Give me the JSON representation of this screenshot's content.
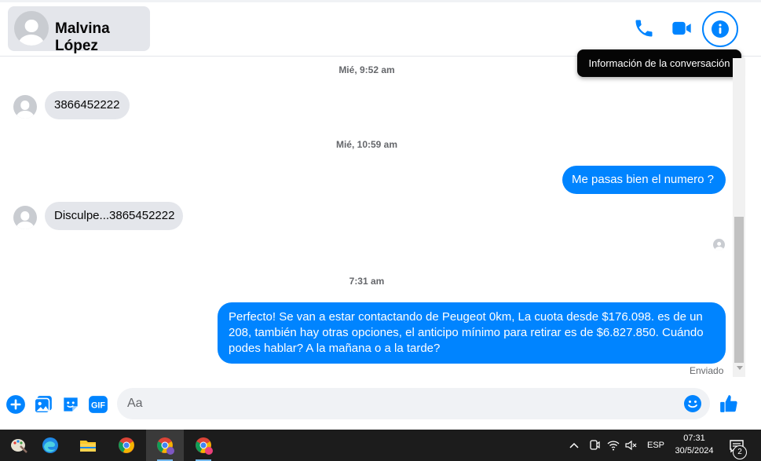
{
  "header": {
    "contact_name": "Malvina López",
    "tooltip": "Información de la conversación"
  },
  "messages": {
    "ts1": "Mié, 9:52 am",
    "m1": "3866452222",
    "ts2": "Mié, 10:59 am",
    "m2": "Me pasas bien el numero ?",
    "m3": "Disculpe...3865452222",
    "ts3": "7:31 am",
    "m4": "Perfecto!  Se van a estar contactando de Peugeot 0km, La cuota desde $176.098. es de un 208, también hay otras opciones, el anticipo mínimo para retirar es de $6.827.850. Cuándo podes hablar? A la mañana o a la tarde?",
    "status": "Enviado"
  },
  "composer": {
    "placeholder": "Aa"
  },
  "taskbar": {
    "language": "ESP",
    "time": "07:31",
    "date": "30/5/2024",
    "notification_count": "2"
  },
  "colors": {
    "accent": "#0084ff",
    "incoming_bubble": "#e4e6eb"
  }
}
